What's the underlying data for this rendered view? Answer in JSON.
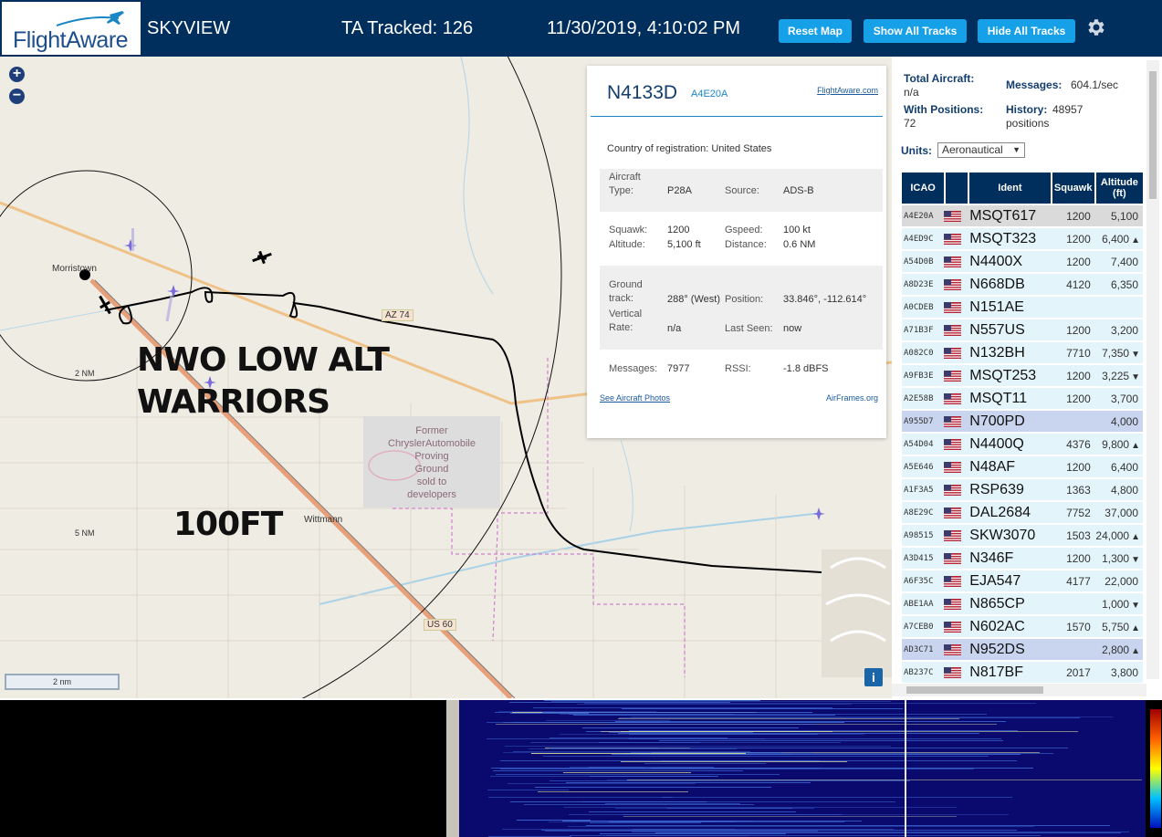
{
  "header": {
    "logo_text": "FlightAware",
    "app_name": "SKYVIEW",
    "tracked": "TA Tracked: 126",
    "datetime": "11/30/2019, 4:10:02 PM",
    "btn_reset": "Reset Map",
    "btn_show": "Show All Tracks",
    "btn_hide": "Hide All Tracks"
  },
  "map": {
    "zoom_in": "+",
    "zoom_out": "−",
    "overlay_title_1": "NWO LOW ALT",
    "overlay_title_2": "WARRIORS",
    "overlay_alt": "100FT",
    "place_morristown": "Morristown",
    "place_wittmann": "Wittmann",
    "ring_2nm": "2 NM",
    "ring_5nm": "5 NM",
    "road_az74": "AZ 74",
    "road_us60": "US 60",
    "poi_lines": [
      "Former",
      "ChryslerAutomobile",
      "Proving",
      "Ground",
      "sold to",
      "developers"
    ],
    "scale_label": "2 nm",
    "info_label": "i"
  },
  "popup": {
    "ident": "N4133D",
    "hex": "A4E20A",
    "fa_link": "FlightAware.com",
    "country_label": "Country of registration:",
    "country_value": "United States",
    "aircraft_type_label": "Aircraft Type:",
    "aircraft_type_value": "P28A",
    "source_label": "Source:",
    "source_value": "ADS-B",
    "squawk_label": "Squawk:",
    "squawk_value": "1200",
    "gspeed_label": "Gspeed:",
    "gspeed_value": "100 kt",
    "altitude_label": "Altitude:",
    "altitude_value": "5,100 ft",
    "distance_label": "Distance:",
    "distance_value": "0.6 NM",
    "ground_track_label": "Ground track:",
    "ground_track_value": "288° (West)",
    "position_label": "Position:",
    "position_value": "33.846°, -112.614°",
    "vertical_rate_label": "Vertical Rate:",
    "vertical_rate_value": "n/a",
    "last_seen_label": "Last Seen:",
    "last_seen_value": "now",
    "messages_label": "Messages:",
    "messages_value": "7977",
    "rssi_label": "RSSI:",
    "rssi_value": "-1.8 dBFS",
    "photos_link": "See Aircraft Photos",
    "airframes_link": "AirFrames.org"
  },
  "sidebar": {
    "total_label": "Total Aircraft:",
    "total_value": "n/a",
    "messages_label": "Messages:",
    "messages_value": "604.1/sec",
    "positions_label": "With Positions:",
    "positions_value": "72",
    "history_label": "History:",
    "history_value": "48957 positions",
    "units_label": "Units:",
    "units_value": "Aeronautical",
    "columns": [
      "ICAO",
      "Ident",
      "Squawk",
      "Altitude (ft)"
    ],
    "rows": [
      {
        "icao": "A4E20A",
        "ident": "MSQT617",
        "squawk": "1200",
        "alt": "5,100",
        "trend": ""
      },
      {
        "icao": "A4ED9C",
        "ident": "MSQT323",
        "squawk": "1200",
        "alt": "6,400",
        "trend": "▲"
      },
      {
        "icao": "A54D0B",
        "ident": "N4400X",
        "squawk": "1200",
        "alt": "7,400",
        "trend": ""
      },
      {
        "icao": "A8D23E",
        "ident": "N668DB",
        "squawk": "4120",
        "alt": "6,350",
        "trend": ""
      },
      {
        "icao": "A0CDEB",
        "ident": "N151AE",
        "squawk": "",
        "alt": "",
        "trend": ""
      },
      {
        "icao": "A71B3F",
        "ident": "N557US",
        "squawk": "1200",
        "alt": "3,200",
        "trend": ""
      },
      {
        "icao": "A082C0",
        "ident": "N132BH",
        "squawk": "7710",
        "alt": "7,350",
        "trend": "▼"
      },
      {
        "icao": "A9FB3E",
        "ident": "MSQT253",
        "squawk": "1200",
        "alt": "3,225",
        "trend": "▼"
      },
      {
        "icao": "A2E58B",
        "ident": "MSQT11",
        "squawk": "1200",
        "alt": "3,700",
        "trend": ""
      },
      {
        "icao": "A955D7",
        "ident": "N700PD",
        "squawk": "",
        "alt": "4,000",
        "trend": ""
      },
      {
        "icao": "A54D04",
        "ident": "N4400Q",
        "squawk": "4376",
        "alt": "9,800",
        "trend": "▲"
      },
      {
        "icao": "A5E646",
        "ident": "N48AF",
        "squawk": "1200",
        "alt": "6,400",
        "trend": ""
      },
      {
        "icao": "A1F3A5",
        "ident": "RSP639",
        "squawk": "1363",
        "alt": "4,800",
        "trend": ""
      },
      {
        "icao": "A8E29C",
        "ident": "DAL2684",
        "squawk": "7752",
        "alt": "37,000",
        "trend": ""
      },
      {
        "icao": "A98515",
        "ident": "SKW3070",
        "squawk": "1503",
        "alt": "24,000",
        "trend": "▲"
      },
      {
        "icao": "A3D415",
        "ident": "N346F",
        "squawk": "1200",
        "alt": "1,300",
        "trend": "▼"
      },
      {
        "icao": "A6F35C",
        "ident": "EJA547",
        "squawk": "4177",
        "alt": "22,000",
        "trend": ""
      },
      {
        "icao": "ABE1AA",
        "ident": "N865CP",
        "squawk": "",
        "alt": "1,000",
        "trend": "▼"
      },
      {
        "icao": "A7CEB0",
        "ident": "N602AC",
        "squawk": "1570",
        "alt": "5,750",
        "trend": "▲"
      },
      {
        "icao": "AD3C71",
        "ident": "N952DS",
        "squawk": "",
        "alt": "2,800",
        "trend": "▲"
      },
      {
        "icao": "AB237C",
        "ident": "N817BF",
        "squawk": "2017",
        "alt": "3,800",
        "trend": ""
      }
    ]
  },
  "colors": {
    "header_bg": "#002f5d",
    "button": "#15a0e8",
    "row_bg": "#e4f4fb",
    "row_selected": "#c9d5ef"
  }
}
